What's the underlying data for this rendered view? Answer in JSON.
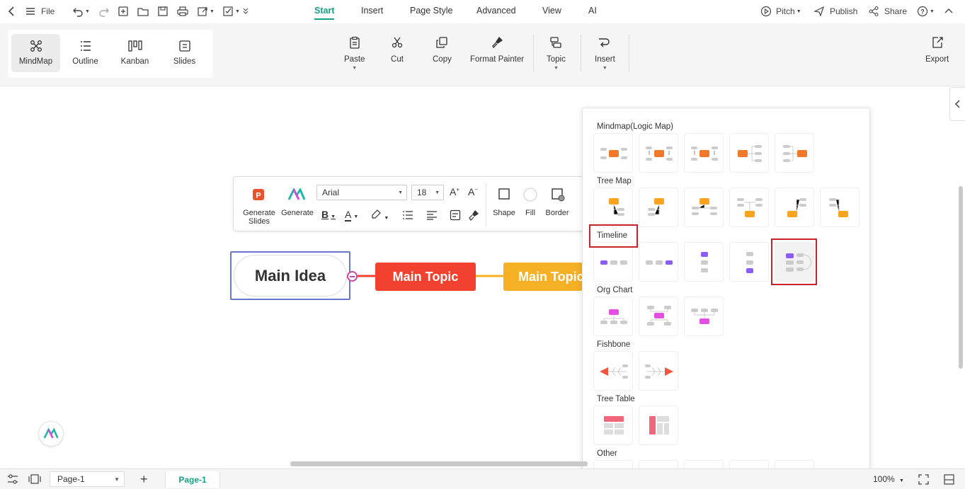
{
  "topbar": {
    "file_label": "File",
    "menu_tabs": [
      {
        "label": "Start",
        "active": true
      },
      {
        "label": "Insert"
      },
      {
        "label": "Page Style"
      },
      {
        "label": "Advanced"
      },
      {
        "label": "View"
      },
      {
        "label": "AI"
      }
    ],
    "pitch_label": "Pitch",
    "publish_label": "Publish",
    "share_label": "Share"
  },
  "views": [
    {
      "label": "MindMap",
      "icon": "mindmap-icon",
      "active": true
    },
    {
      "label": "Outline",
      "icon": "outline-icon"
    },
    {
      "label": "Kanban",
      "icon": "kanban-icon"
    },
    {
      "label": "Slides",
      "icon": "slides-icon"
    }
  ],
  "ribbon": {
    "paste": "Paste",
    "cut": "Cut",
    "copy": "Copy",
    "format_painter": "Format Painter",
    "topic": "Topic",
    "insert": "Insert",
    "export": "Export"
  },
  "format_toolbar": {
    "generate_slides": "Generate Slides",
    "generate": "Generate",
    "font_family": "Arial",
    "font_size": "18",
    "shape": "Shape",
    "fill": "Fill",
    "border": "Border"
  },
  "mindmap": {
    "main_idea": "Main Idea",
    "topic_1": "Main Topic",
    "topic_2": "Main Topic",
    "colors": {
      "topic_1": "#f2412f",
      "topic_2": "#f5b025",
      "frame": "#6677cc"
    }
  },
  "layout_panel": {
    "sections": [
      {
        "title": "Mindmap(Logic Map)",
        "count": 5
      },
      {
        "title": "Tree Map",
        "count": 6
      },
      {
        "title": "Timeline",
        "count": 5
      },
      {
        "title": "Org Chart",
        "count": 3
      },
      {
        "title": "Fishbone",
        "count": 2
      },
      {
        "title": "Tree Table",
        "count": 2
      },
      {
        "title": "Other",
        "count": 5
      }
    ]
  },
  "statusbar": {
    "page_select": "Page-1",
    "active_page": "Page-1",
    "zoom": "100%"
  },
  "accent_color": "#16a085",
  "highlight_color": "#c8232c"
}
